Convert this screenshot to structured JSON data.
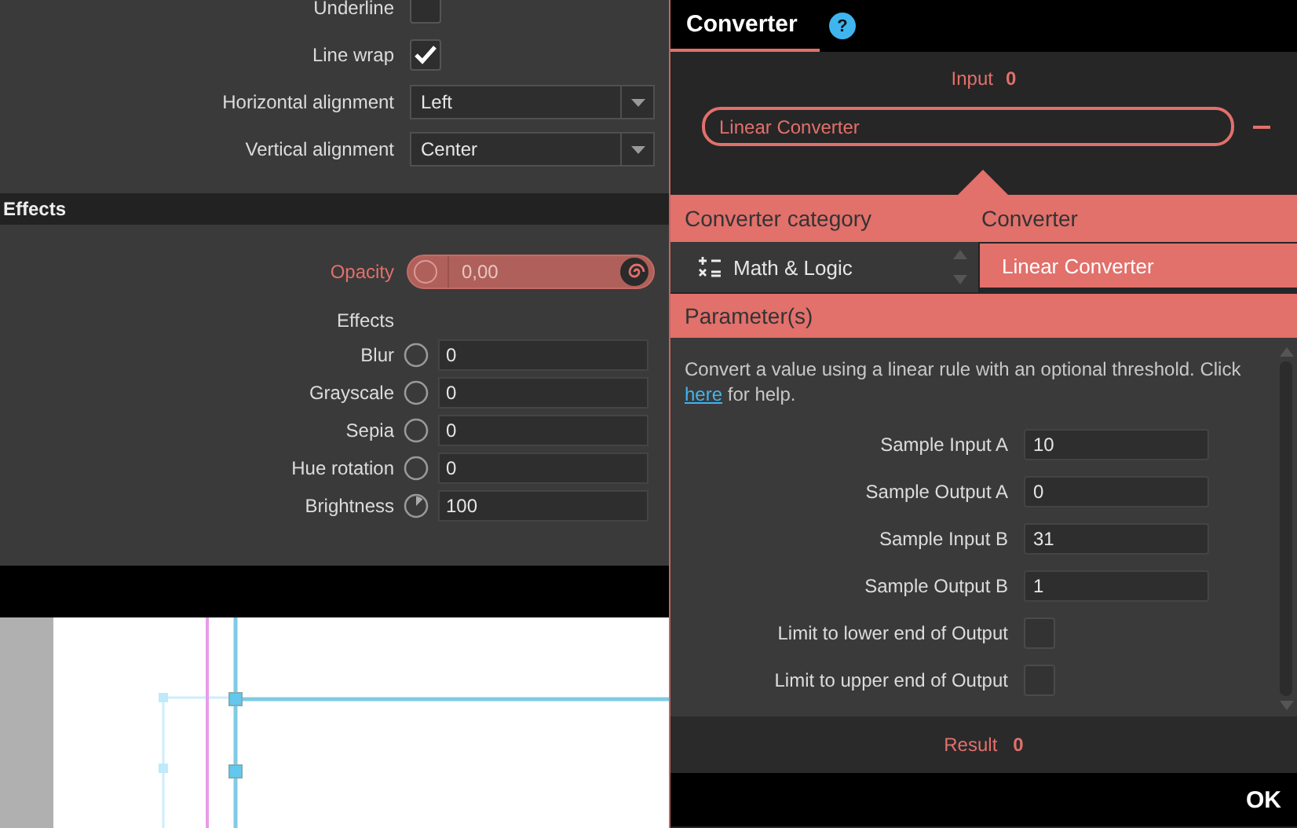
{
  "properties": {
    "rows": [
      {
        "kind": "checkbox",
        "label": "Underline",
        "checked": false
      },
      {
        "kind": "checkbox",
        "label": "Line wrap",
        "checked": true
      },
      {
        "kind": "dropdown",
        "label": "Horizontal alignment",
        "value": "Left"
      },
      {
        "kind": "dropdown",
        "label": "Vertical alignment",
        "value": "Center"
      }
    ]
  },
  "effects": {
    "title": "Effects",
    "opacity": {
      "label": "Opacity",
      "value": "0,00",
      "linked": true
    },
    "subtitle": "Effects",
    "filters": [
      {
        "label": "Blur",
        "value": "0",
        "modified": false
      },
      {
        "label": "Grayscale",
        "value": "0",
        "modified": false
      },
      {
        "label": "Sepia",
        "value": "0",
        "modified": false
      },
      {
        "label": "Hue rotation",
        "value": "0",
        "modified": false
      },
      {
        "label": "Brightness",
        "value": "100",
        "modified": true
      }
    ]
  },
  "converter": {
    "tab": {
      "label": "Converter",
      "selected": true
    },
    "help": "?",
    "input": {
      "label": "Input",
      "value": "0"
    },
    "converter_field": {
      "value": "Linear Converter"
    },
    "columns": [
      "Converter category",
      "Converter"
    ],
    "categories": [
      {
        "label": "Math & Logic"
      }
    ],
    "converters": [
      {
        "label": "Linear Converter",
        "selected": true
      }
    ],
    "parameters": {
      "title": "Parameter(s)",
      "description": "Convert a value using a linear rule with an optional threshold. Click ",
      "link": "here",
      "description_end": " for help.",
      "fields": [
        {
          "kind": "text",
          "label": "Sample Input A",
          "value": "10"
        },
        {
          "kind": "text",
          "label": "Sample Output A",
          "value": "0"
        },
        {
          "kind": "text",
          "label": "Sample Input B",
          "value": "31"
        },
        {
          "kind": "text",
          "label": "Sample Output B",
          "value": "1"
        },
        {
          "kind": "checkbox",
          "label": "Limit to lower end of Output",
          "checked": false
        },
        {
          "kind": "checkbox",
          "label": "Limit to upper end of Output",
          "checked": false
        }
      ]
    },
    "result": {
      "label": "Result",
      "value": "0"
    },
    "ok": "OK"
  }
}
